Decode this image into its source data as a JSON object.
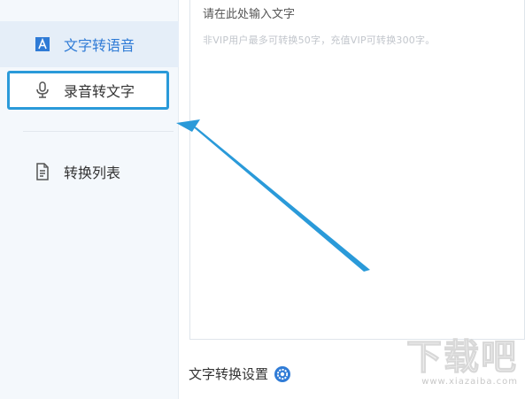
{
  "sidebar": {
    "items": [
      {
        "label": "文字转语音",
        "icon": "text-a-icon",
        "active": true
      },
      {
        "label": "录音转文字",
        "icon": "microphone-icon",
        "highlighted": true
      },
      {
        "label": "转换列表",
        "icon": "document-list-icon"
      }
    ]
  },
  "editor": {
    "placeholder": "请在此处输入文字",
    "hint": "非VIP用户最多可转换50字，充值VIP可转换300字。"
  },
  "settings": {
    "label": "文字转换设置",
    "icon": "gear-icon"
  },
  "watermark": {
    "main": "下载吧",
    "sub": "www.xiazaiba.com"
  },
  "colors": {
    "accent": "#2f7bd6",
    "highlight_border": "#2a9ad9",
    "arrow": "#2a9ad9",
    "sidebar_bg": "#f4f8fc"
  }
}
